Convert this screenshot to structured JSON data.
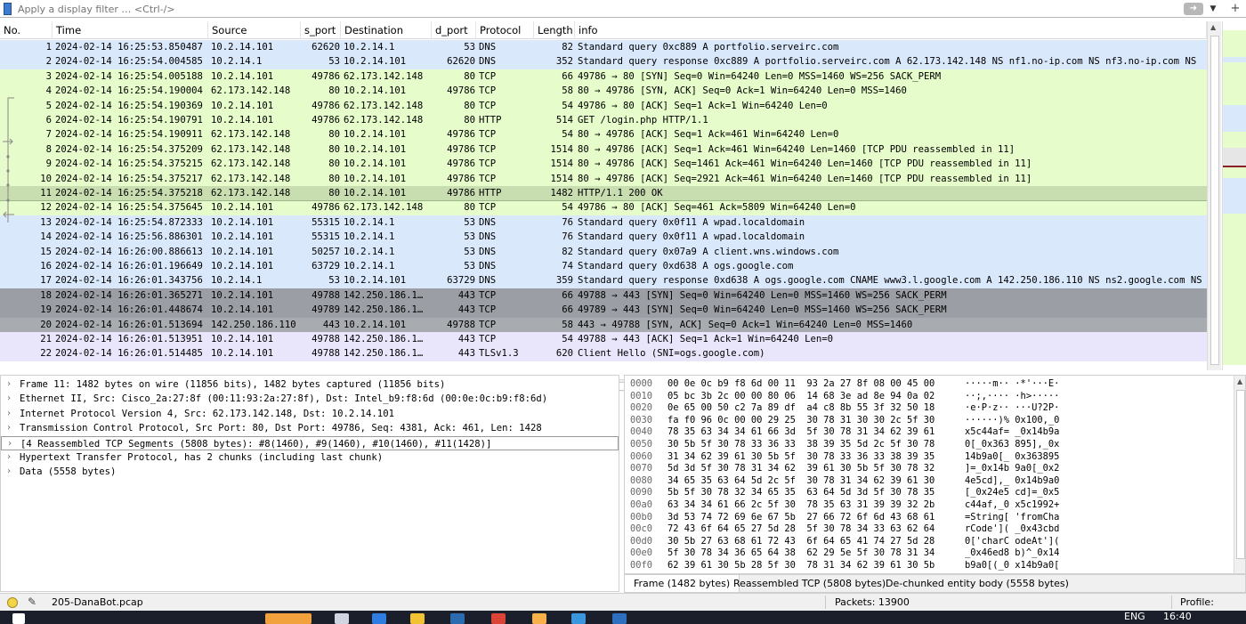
{
  "filter": {
    "placeholder": "Apply a display filter … <Ctrl-/>",
    "apply_icon": "arrow-right-icon",
    "dropdown_icon": "chevron-down-icon",
    "add_icon": "plus-icon"
  },
  "packet_list": {
    "columns": [
      "No.",
      "Time",
      "Source",
      "s_port",
      "Destination",
      "d_port",
      "Protocol",
      "Length",
      "info"
    ],
    "colors": {
      "dns": "#dae8fb",
      "tcp": "#e6fcca",
      "tcp_selected": "#c8ddb0",
      "syn_dark": "#9b9ea4",
      "syn_mid": "#a8abaf",
      "tls": "#e9e6fc"
    },
    "rows": [
      {
        "no": "1",
        "time": "2024-02-14 16:25:53.850487",
        "src": "10.2.14.101",
        "sport": "62620",
        "dst": "10.2.14.1",
        "dport": "53",
        "proto": "DNS",
        "len": "82",
        "info": "Standard query 0xc889 A portfolio.serveirc.com",
        "bg": "dns"
      },
      {
        "no": "2",
        "time": "2024-02-14 16:25:54.004585",
        "src": "10.2.14.1",
        "sport": "53",
        "dst": "10.2.14.101",
        "dport": "62620",
        "proto": "DNS",
        "len": "352",
        "info": "Standard query response 0xc889 A portfolio.serveirc.com A 62.173.142.148 NS nf1.no-ip.com NS nf3.no-ip.com NS",
        "bg": "dns"
      },
      {
        "no": "3",
        "time": "2024-02-14 16:25:54.005188",
        "src": "10.2.14.101",
        "sport": "49786",
        "dst": "62.173.142.148",
        "dport": "80",
        "proto": "TCP",
        "len": "66",
        "info": "49786 → 80 [SYN] Seq=0 Win=64240 Len=0 MSS=1460 WS=256 SACK_PERM",
        "bg": "tcp"
      },
      {
        "no": "4",
        "time": "2024-02-14 16:25:54.190004",
        "src": "62.173.142.148",
        "sport": "80",
        "dst": "10.2.14.101",
        "dport": "49786",
        "proto": "TCP",
        "len": "58",
        "info": "80 → 49786 [SYN, ACK] Seq=0 Ack=1 Win=64240 Len=0 MSS=1460",
        "bg": "tcp"
      },
      {
        "no": "5",
        "time": "2024-02-14 16:25:54.190369",
        "src": "10.2.14.101",
        "sport": "49786",
        "dst": "62.173.142.148",
        "dport": "80",
        "proto": "TCP",
        "len": "54",
        "info": "49786 → 80 [ACK] Seq=1 Ack=1 Win=64240 Len=0",
        "bg": "tcp"
      },
      {
        "no": "6",
        "time": "2024-02-14 16:25:54.190791",
        "src": "10.2.14.101",
        "sport": "49786",
        "dst": "62.173.142.148",
        "dport": "80",
        "proto": "HTTP",
        "len": "514",
        "info": "GET /login.php HTTP/1.1",
        "bg": "tcp"
      },
      {
        "no": "7",
        "time": "2024-02-14 16:25:54.190911",
        "src": "62.173.142.148",
        "sport": "80",
        "dst": "10.2.14.101",
        "dport": "49786",
        "proto": "TCP",
        "len": "54",
        "info": "80 → 49786 [ACK] Seq=1 Ack=461 Win=64240 Len=0",
        "bg": "tcp"
      },
      {
        "no": "8",
        "time": "2024-02-14 16:25:54.375209",
        "src": "62.173.142.148",
        "sport": "80",
        "dst": "10.2.14.101",
        "dport": "49786",
        "proto": "TCP",
        "len": "1514",
        "info": "80 → 49786 [ACK] Seq=1 Ack=461 Win=64240 Len=1460 [TCP PDU reassembled in 11]",
        "bg": "tcp"
      },
      {
        "no": "9",
        "time": "2024-02-14 16:25:54.375215",
        "src": "62.173.142.148",
        "sport": "80",
        "dst": "10.2.14.101",
        "dport": "49786",
        "proto": "TCP",
        "len": "1514",
        "info": "80 → 49786 [ACK] Seq=1461 Ack=461 Win=64240 Len=1460 [TCP PDU reassembled in 11]",
        "bg": "tcp"
      },
      {
        "no": "10",
        "time": "2024-02-14 16:25:54.375217",
        "src": "62.173.142.148",
        "sport": "80",
        "dst": "10.2.14.101",
        "dport": "49786",
        "proto": "TCP",
        "len": "1514",
        "info": "80 → 49786 [ACK] Seq=2921 Ack=461 Win=64240 Len=1460 [TCP PDU reassembled in 11]",
        "bg": "tcp"
      },
      {
        "no": "11",
        "time": "2024-02-14 16:25:54.375218",
        "src": "62.173.142.148",
        "sport": "80",
        "dst": "10.2.14.101",
        "dport": "49786",
        "proto": "HTTP",
        "len": "1482",
        "info": "HTTP/1.1 200 OK",
        "bg": "tcp_selected"
      },
      {
        "no": "12",
        "time": "2024-02-14 16:25:54.375645",
        "src": "10.2.14.101",
        "sport": "49786",
        "dst": "62.173.142.148",
        "dport": "80",
        "proto": "TCP",
        "len": "54",
        "info": "49786 → 80 [ACK] Seq=461 Ack=5809 Win=64240 Len=0",
        "bg": "tcp"
      },
      {
        "no": "13",
        "time": "2024-02-14 16:25:54.872333",
        "src": "10.2.14.101",
        "sport": "55315",
        "dst": "10.2.14.1",
        "dport": "53",
        "proto": "DNS",
        "len": "76",
        "info": "Standard query 0x0f11 A wpad.localdomain",
        "bg": "dns"
      },
      {
        "no": "14",
        "time": "2024-02-14 16:25:56.886301",
        "src": "10.2.14.101",
        "sport": "55315",
        "dst": "10.2.14.1",
        "dport": "53",
        "proto": "DNS",
        "len": "76",
        "info": "Standard query 0x0f11 A wpad.localdomain",
        "bg": "dns"
      },
      {
        "no": "15",
        "time": "2024-02-14 16:26:00.886613",
        "src": "10.2.14.101",
        "sport": "50257",
        "dst": "10.2.14.1",
        "dport": "53",
        "proto": "DNS",
        "len": "82",
        "info": "Standard query 0x07a9 A client.wns.windows.com",
        "bg": "dns"
      },
      {
        "no": "16",
        "time": "2024-02-14 16:26:01.196649",
        "src": "10.2.14.101",
        "sport": "63729",
        "dst": "10.2.14.1",
        "dport": "53",
        "proto": "DNS",
        "len": "74",
        "info": "Standard query 0xd638 A ogs.google.com",
        "bg": "dns"
      },
      {
        "no": "17",
        "time": "2024-02-14 16:26:01.343756",
        "src": "10.2.14.1",
        "sport": "53",
        "dst": "10.2.14.101",
        "dport": "63729",
        "proto": "DNS",
        "len": "359",
        "info": "Standard query response 0xd638 A ogs.google.com CNAME www3.l.google.com A 142.250.186.110 NS ns2.google.com NS",
        "bg": "dns"
      },
      {
        "no": "18",
        "time": "2024-02-14 16:26:01.365271",
        "src": "10.2.14.101",
        "sport": "49788",
        "dst": "142.250.186.1…",
        "dport": "443",
        "proto": "TCP",
        "len": "66",
        "info": "49788 → 443 [SYN] Seq=0 Win=64240 Len=0 MSS=1460 WS=256 SACK_PERM",
        "bg": "syn_dark"
      },
      {
        "no": "19",
        "time": "2024-02-14 16:26:01.448674",
        "src": "10.2.14.101",
        "sport": "49789",
        "dst": "142.250.186.1…",
        "dport": "443",
        "proto": "TCP",
        "len": "66",
        "info": "49789 → 443 [SYN] Seq=0 Win=64240 Len=0 MSS=1460 WS=256 SACK_PERM",
        "bg": "syn_dark"
      },
      {
        "no": "20",
        "time": "2024-02-14 16:26:01.513694",
        "src": "142.250.186.110",
        "sport": "443",
        "dst": "10.2.14.101",
        "dport": "49788",
        "proto": "TCP",
        "len": "58",
        "info": "443 → 49788 [SYN, ACK] Seq=0 Ack=1 Win=64240 Len=0 MSS=1460",
        "bg": "syn_mid"
      },
      {
        "no": "21",
        "time": "2024-02-14 16:26:01.513951",
        "src": "10.2.14.101",
        "sport": "49788",
        "dst": "142.250.186.1…",
        "dport": "443",
        "proto": "TCP",
        "len": "54",
        "info": "49788 → 443 [ACK] Seq=1 Ack=1 Win=64240 Len=0",
        "bg": "tls"
      },
      {
        "no": "22",
        "time": "2024-02-14 16:26:01.514485",
        "src": "10.2.14.101",
        "sport": "49788",
        "dst": "142.250.186.1…",
        "dport": "443",
        "proto": "TLSv1.3",
        "len": "620",
        "info": "Client Hello (SNI=ogs.google.com)",
        "bg": "tls"
      }
    ]
  },
  "details": [
    {
      "text": "Frame 11: 1482 bytes on wire (11856 bits), 1482 bytes captured (11856 bits)",
      "toggle": "›",
      "selected": false
    },
    {
      "text": "Ethernet II, Src: Cisco_2a:27:8f (00:11:93:2a:27:8f), Dst: Intel_b9:f8:6d (00:0e:0c:b9:f8:6d)",
      "toggle": "›",
      "selected": false
    },
    {
      "text": "Internet Protocol Version 4, Src: 62.173.142.148, Dst: 10.2.14.101",
      "toggle": "›",
      "selected": false
    },
    {
      "text": "Transmission Control Protocol, Src Port: 80, Dst Port: 49786, Seq: 4381, Ack: 461, Len: 1428",
      "toggle": "›",
      "selected": false
    },
    {
      "text": "[4 Reassembled TCP Segments (5808 bytes): #8(1460), #9(1460), #10(1460), #11(1428)]",
      "toggle": "›",
      "selected": true
    },
    {
      "text": "Hypertext Transfer Protocol, has 2 chunks (including last chunk)",
      "toggle": "›",
      "selected": false
    },
    {
      "text": "Data (5558 bytes)",
      "toggle": "›",
      "selected": false
    }
  ],
  "bytes": [
    {
      "off": "0000",
      "hex": "00 0e 0c b9 f8 6d 00 11  93 2a 27 8f 08 00 45 00",
      "ascii": "·····m·· ·*'···E·"
    },
    {
      "off": "0010",
      "hex": "05 bc 3b 2c 00 00 80 06  14 68 3e ad 8e 94 0a 02",
      "ascii": "··;,···· ·h>·····"
    },
    {
      "off": "0020",
      "hex": "0e 65 00 50 c2 7a 89 df  a4 c8 8b 55 3f 32 50 18",
      "ascii": "·e·P·z·· ···U?2P·"
    },
    {
      "off": "0030",
      "hex": "fa f0 96 0c 00 00 29 25  30 78 31 30 30 2c 5f 30",
      "ascii": "······)% 0x100,_0"
    },
    {
      "off": "0040",
      "hex": "78 35 63 34 34 61 66 3d  5f 30 78 31 34 62 39 61",
      "ascii": "x5c44af= _0x14b9a"
    },
    {
      "off": "0050",
      "hex": "30 5b 5f 30 78 33 36 33  38 39 35 5d 2c 5f 30 78",
      "ascii": "0[_0x363 895],_0x"
    },
    {
      "off": "0060",
      "hex": "31 34 62 39 61 30 5b 5f  30 78 33 36 33 38 39 35",
      "ascii": "14b9a0[_ 0x363895"
    },
    {
      "off": "0070",
      "hex": "5d 3d 5f 30 78 31 34 62  39 61 30 5b 5f 30 78 32",
      "ascii": "]=_0x14b 9a0[_0x2"
    },
    {
      "off": "0080",
      "hex": "34 65 35 63 64 5d 2c 5f  30 78 31 34 62 39 61 30",
      "ascii": "4e5cd],_ 0x14b9a0"
    },
    {
      "off": "0090",
      "hex": "5b 5f 30 78 32 34 65 35  63 64 5d 3d 5f 30 78 35",
      "ascii": "[_0x24e5 cd]=_0x5"
    },
    {
      "off": "00a0",
      "hex": "63 34 34 61 66 2c 5f 30  78 35 63 31 39 39 32 2b",
      "ascii": "c44af,_0 x5c1992+"
    },
    {
      "off": "00b0",
      "hex": "3d 53 74 72 69 6e 67 5b  27 66 72 6f 6d 43 68 61",
      "ascii": "=String[ 'fromCha"
    },
    {
      "off": "00c0",
      "hex": "72 43 6f 64 65 27 5d 28  5f 30 78 34 33 63 62 64",
      "ascii": "rCode']( _0x43cbd"
    },
    {
      "off": "00d0",
      "hex": "30 5b 27 63 68 61 72 43  6f 64 65 41 74 27 5d 28",
      "ascii": "0['charC odeAt']("
    },
    {
      "off": "00e0",
      "hex": "5f 30 78 34 36 65 64 38  62 29 5e 5f 30 78 31 34",
      "ascii": "_0x46ed8 b)^_0x14"
    },
    {
      "off": "00f0",
      "hex": "62 39 61 30 5b 28 5f 30  78 31 34 62 39 61 30 5b",
      "ascii": "b9a0[(_0 x14b9a0["
    }
  ],
  "byte_tabs": [
    "Frame (1482 bytes)",
    "Reassembled TCP (5808 bytes)",
    "De-chunked entity body (5558 bytes)"
  ],
  "status": {
    "file": "205-DanaBot.pcap",
    "packets": "Packets: 13900",
    "profile": "Profile: Default"
  },
  "taskbar": {
    "time": "16:40",
    "lang": "ENG"
  }
}
